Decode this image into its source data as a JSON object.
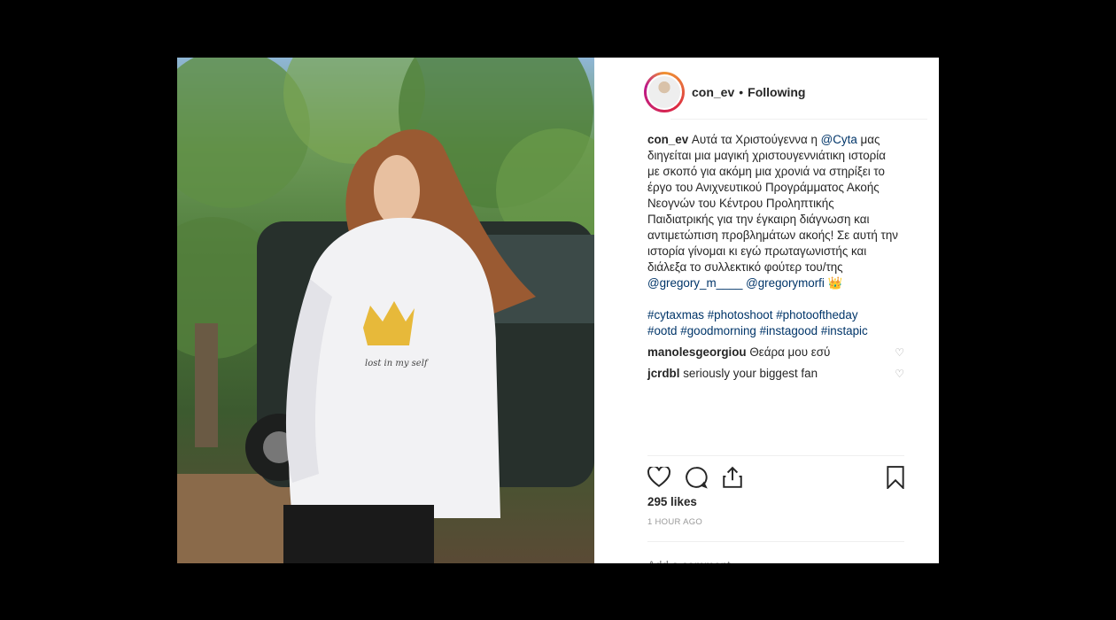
{
  "header": {
    "username": "con_ev",
    "separator": "•",
    "follow_status": "Following"
  },
  "caption": {
    "username": "con_ev",
    "text_1": "Αυτά τα Χριστούγεννα η",
    "mention_1": "@Cyta",
    "text_2": "μας διηγείται μια μαγική χριστουγεννιάτικη ιστορία με σκοπό για ακόμη μια χρονιά να στηρίξει το έργο του Ανιχνευτικού Προγράμματος Ακοής Νεογνών του Κέντρου Προληπτικής Παιδιατρικής για την έγκαιρη διάγνωση και αντιμετώπιση προβλημάτων ακοής! Σε αυτή την ιστορία γίνομαι κι εγώ πρωταγωνιστής και διάλεξα το συλλεκτικό φούτερ του/της",
    "mention_2": "@gregory_m____",
    "mention_3": "@gregorymorfi",
    "emoji": "👑"
  },
  "hashtags": [
    "#cytaxmas",
    "#photoshoot",
    "#photooftheday",
    "#ootd",
    "#goodmorning",
    "#instagood",
    "#instapic"
  ],
  "comments": [
    {
      "username": "manolesgeorgiou",
      "text": "Θεάρα μου εσύ"
    },
    {
      "username": "jcrdbl",
      "text": "seriously your biggest fan"
    }
  ],
  "likes": "295 likes",
  "timestamp": "1 HOUR AGO",
  "add_comment_placeholder": "Add a comment...",
  "more_options": "•••",
  "icons": [
    "heart-icon",
    "comment-icon",
    "share-icon",
    "bookmark-icon"
  ]
}
